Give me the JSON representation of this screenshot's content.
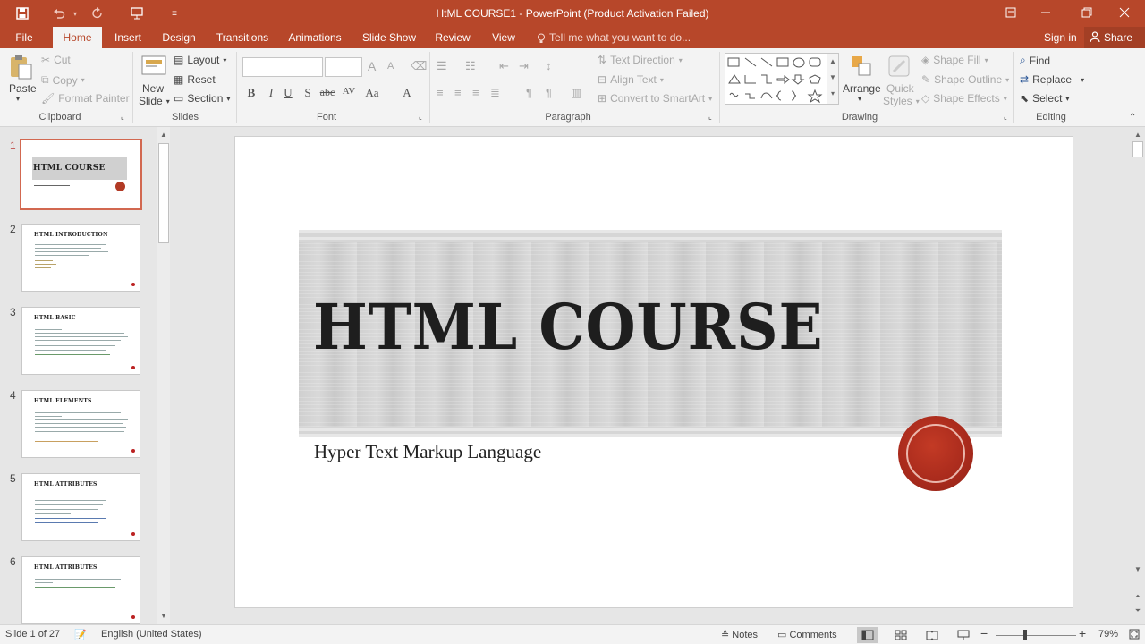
{
  "window": {
    "title": "HtML COURSE1 - PowerPoint (Product Activation Failed)",
    "colors": {
      "accent": "#b7472a",
      "ribbon_bg": "#f3f3f3",
      "selected_thumb": "#d26850"
    }
  },
  "quick_access": [
    "save-icon",
    "undo-icon",
    "redo-icon",
    "start-from-beginning-icon",
    "customize-icon"
  ],
  "tabs": [
    {
      "label": "File"
    },
    {
      "label": "Home"
    },
    {
      "label": "Insert"
    },
    {
      "label": "Design"
    },
    {
      "label": "Transitions"
    },
    {
      "label": "Animations"
    },
    {
      "label": "Slide Show"
    },
    {
      "label": "Review"
    },
    {
      "label": "View"
    }
  ],
  "tell_me": "Tell me what you want to do...",
  "account": {
    "signin": "Sign in",
    "share": "Share"
  },
  "ribbon": {
    "clipboard": {
      "paste": "Paste",
      "cut": "Cut",
      "copy": "Copy",
      "format_painter": "Format Painter",
      "label": "Clipboard"
    },
    "slides": {
      "new_slide": "New",
      "new_slide2": "Slide",
      "layout": "Layout",
      "reset": "Reset",
      "section": "Section",
      "label": "Slides"
    },
    "font": {
      "label": "Font",
      "grow": "A",
      "shrink": "A",
      "clear": "A",
      "bold": "B",
      "italic": "I",
      "underline": "U",
      "shadow": "S",
      "strike": "abc",
      "spacing": "AV",
      "case": "Aa",
      "color": "A"
    },
    "paragraph": {
      "text_direction": "Text Direction",
      "align_text": "Align Text",
      "smartart": "Convert to SmartArt",
      "label": "Paragraph"
    },
    "drawing": {
      "arrange": "Arrange",
      "quick_styles": "Quick",
      "quick_styles2": "Styles",
      "shape_fill": "Shape Fill",
      "shape_outline": "Shape Outline",
      "shape_effects": "Shape Effects",
      "label": "Drawing"
    },
    "editing": {
      "find": "Find",
      "replace": "Replace",
      "select": "Select",
      "label": "Editing"
    }
  },
  "thumbnails": [
    {
      "num": "1",
      "title": "HTML COURSE"
    },
    {
      "num": "2",
      "title": "HTML INTRODUCTION"
    },
    {
      "num": "3",
      "title": "HTML BASIC"
    },
    {
      "num": "4",
      "title": "HTML ELEMENTS"
    },
    {
      "num": "5",
      "title": "HTML ATTRIBUTES"
    },
    {
      "num": "6",
      "title": "HTML ATTRIBUTES"
    }
  ],
  "slide": {
    "title": "HTML COURSE",
    "subtitle": "Hyper Text Markup Language"
  },
  "status": {
    "slide_info": "Slide 1 of 27",
    "language": "English (United States)",
    "notes": "Notes",
    "comments": "Comments",
    "zoom": "79%"
  }
}
